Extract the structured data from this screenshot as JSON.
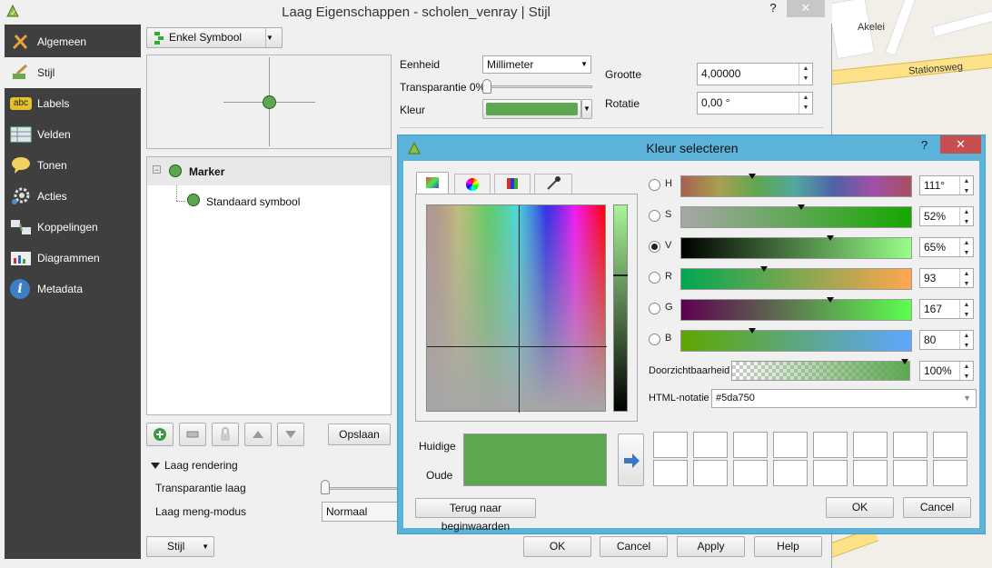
{
  "window": {
    "title": "Laag Eigenschappen - scholen_venray | Stijl",
    "help_glyph": "?",
    "close_glyph": "✕"
  },
  "map": {
    "labels": [
      "Akelei",
      "Stationsweg"
    ]
  },
  "sidebar": {
    "items": [
      {
        "label": "Algemeen",
        "icon": "tools-icon"
      },
      {
        "label": "Stijl",
        "icon": "paintbrush-icon"
      },
      {
        "label": "Labels",
        "icon": "abc-label-icon",
        "icon_text": "abc"
      },
      {
        "label": "Velden",
        "icon": "table-icon"
      },
      {
        "label": "Tonen",
        "icon": "speech-bubble-icon"
      },
      {
        "label": "Acties",
        "icon": "gear-icon"
      },
      {
        "label": "Koppelingen",
        "icon": "join-icon"
      },
      {
        "label": "Diagrammen",
        "icon": "chart-icon"
      },
      {
        "label": "Metadata",
        "icon": "info-icon",
        "icon_text": "i"
      }
    ]
  },
  "style": {
    "renderer_select": "Enkel Symbool",
    "tree": {
      "root": "Marker",
      "child": "Standaard symbool"
    },
    "symbol_color": "#5da750",
    "eenheid_label": "Eenheid",
    "eenheid_value": "Millimeter",
    "transparantie_label": "Transparantie 0%",
    "kleur_label": "Kleur",
    "grootte_label": "Grootte",
    "grootte_value": "4,00000",
    "rotatie_label": "Rotatie",
    "rotatie_value": "0,00 °",
    "opslaan_label": "Opslaan",
    "laag_rendering_label": "Laag rendering",
    "transparantie_laag_label": "Transparantie laag",
    "meng_modus_label": "Laag meng-modus",
    "meng_modus_value": "Normaal",
    "stijl_button": "Stijl"
  },
  "footer": {
    "ok": "OK",
    "cancel": "Cancel",
    "apply": "Apply",
    "help": "Help"
  },
  "color_dialog": {
    "title": "Kleur selecteren",
    "help_glyph": "?",
    "close_glyph": "✕",
    "channels": [
      {
        "letter": "H",
        "value": "111°",
        "level": 0.31,
        "selected": false
      },
      {
        "letter": "S",
        "value": "52%",
        "level": 0.52,
        "selected": false
      },
      {
        "letter": "V",
        "value": "65%",
        "level": 0.65,
        "selected": true
      },
      {
        "letter": "R",
        "value": "93",
        "level": 0.36,
        "selected": false
      },
      {
        "letter": "G",
        "value": "167",
        "level": 0.65,
        "selected": false
      },
      {
        "letter": "B",
        "value": "80",
        "level": 0.31,
        "selected": false
      }
    ],
    "doorzichtbaarheid_label": "Doorzichtbaarheid",
    "doorzichtbaarheid_value": "100%",
    "html_label": "HTML-notatie",
    "html_value": "#5da750",
    "huidige_label": "Huidige",
    "oude_label": "Oude",
    "current_color": "#5da750",
    "reset_button": "Terug naar beginwaarden",
    "ok": "OK",
    "cancel": "Cancel"
  }
}
